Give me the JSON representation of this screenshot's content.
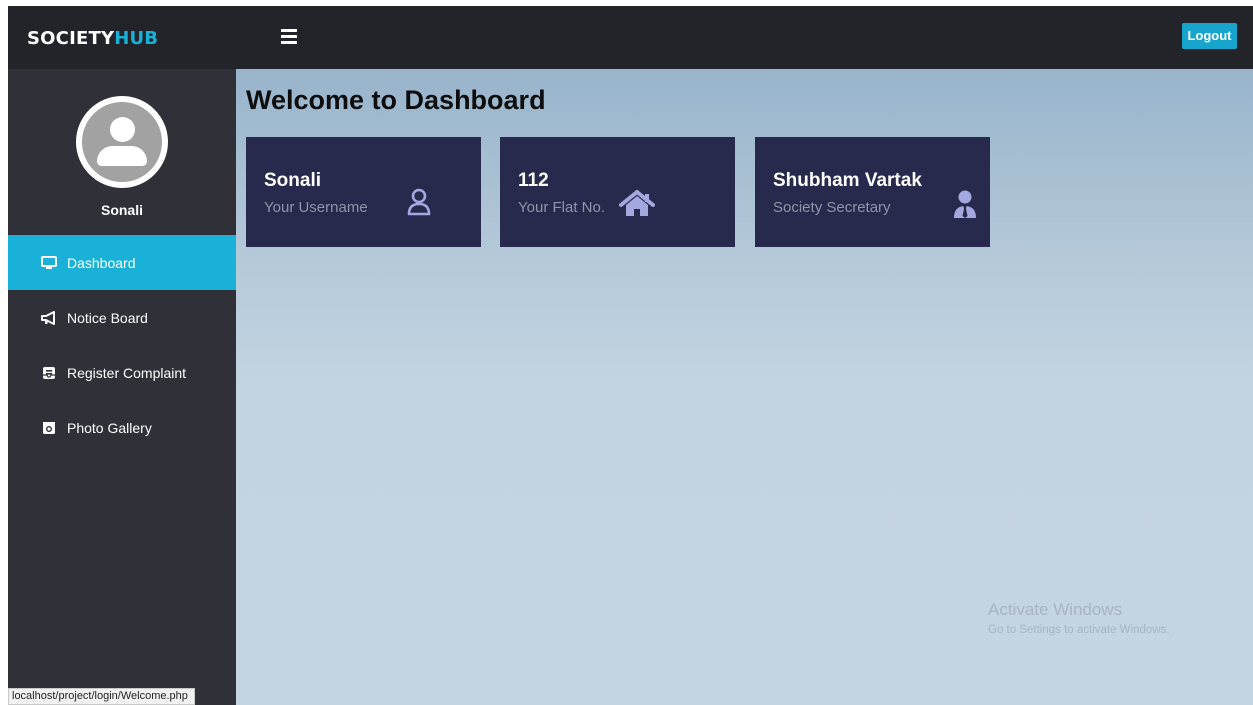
{
  "header": {
    "brand_part1": "SOCIETY",
    "brand_part2": "HUB",
    "menu_icon": "hamburger-icon",
    "logout_label": "Logout"
  },
  "sidebar": {
    "profile_name": "Sonali",
    "avatar_icon": "user-avatar-icon",
    "items": [
      {
        "label": "Dashboard",
        "icon": "monitor-icon",
        "active": true
      },
      {
        "label": "Notice Board",
        "icon": "megaphone-icon",
        "active": false
      },
      {
        "label": "Register Complaint",
        "icon": "envelope-open-icon",
        "active": false
      },
      {
        "label": "Photo Gallery",
        "icon": "camera-icon",
        "active": false
      }
    ]
  },
  "main": {
    "title": "Welcome to Dashboard",
    "cards": [
      {
        "value": "Sonali",
        "label": "Your Username",
        "icon": "user-outline-icon"
      },
      {
        "value": "112",
        "label": "Your Flat No.",
        "icon": "home-icon"
      },
      {
        "value": "Shubham Vartak",
        "label": "Society Secretary",
        "icon": "user-tie-icon"
      }
    ]
  },
  "watermark": {
    "line1": "Activate Windows",
    "line2": "Go to Settings to activate Windows."
  },
  "status_bar": {
    "url": "localhost/project/login/Welcome.php"
  },
  "colors": {
    "accent": "#1ab1d9",
    "topbar": "#232429",
    "sidebar": "#2f3038",
    "card": "#272a4c",
    "card_icon": "#a3a8e0"
  }
}
